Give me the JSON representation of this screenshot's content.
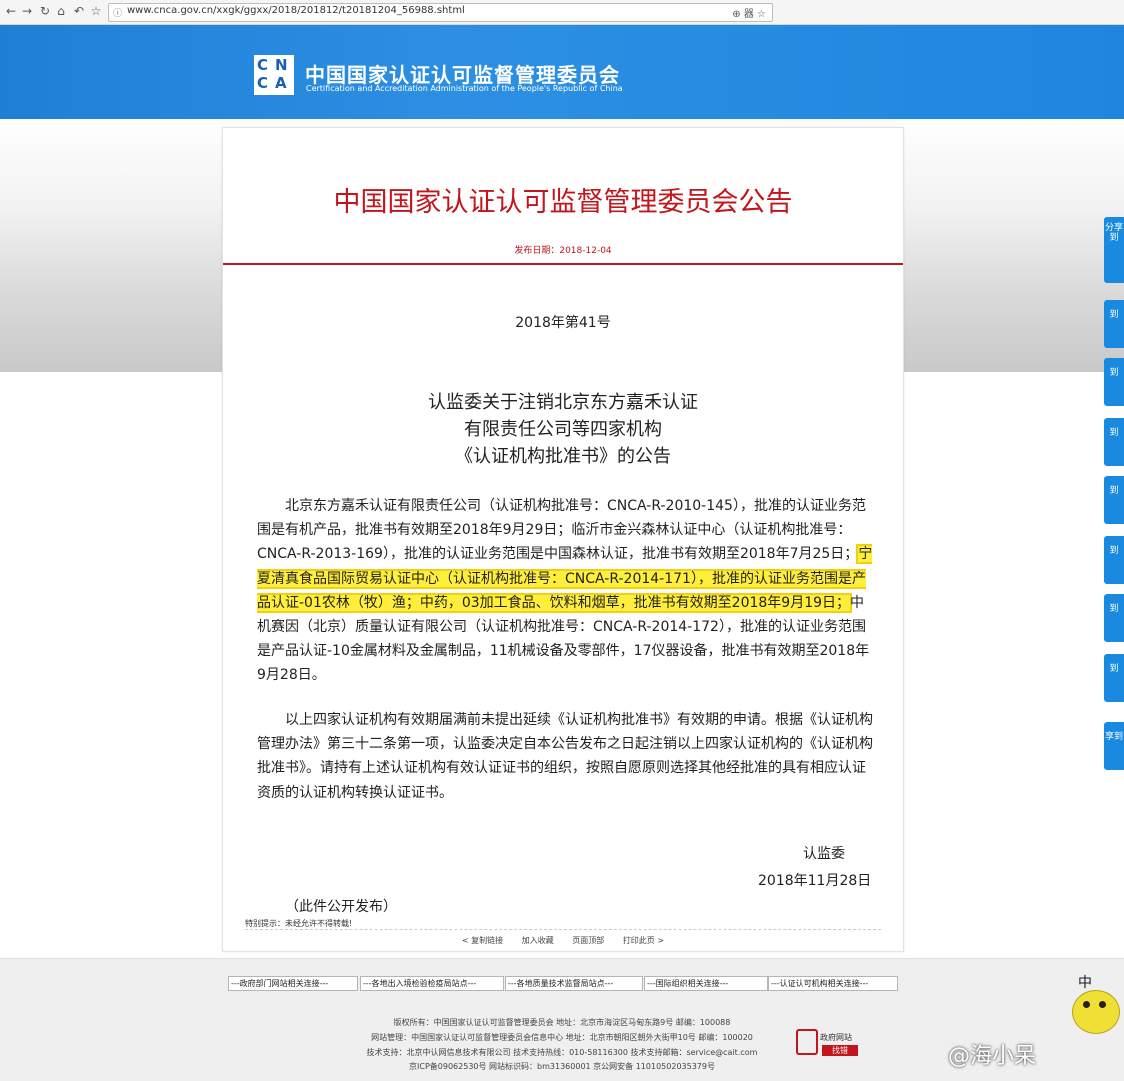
{
  "browser": {
    "url": "www.cnca.gov.cn/xxgk/ggxx/2018/201812/t20181204_56988.shtml",
    "back_icon": "arrow-left-icon",
    "forward_icon": "arrow-right-icon",
    "reload_icon": "reload-icon",
    "home_icon": "home-icon",
    "undo_icon": "undo-icon",
    "star_icon": "star-icon",
    "tools": "⊕ 器 ☆"
  },
  "header": {
    "logo_letters": [
      "C",
      "N",
      "C",
      "A"
    ],
    "org_name_cn": "中国国家认证认可监督管理委员会",
    "org_name_en": "Certification and Accreditation Administration of the People's Republic of China"
  },
  "article": {
    "title": "中国国家认证认可监督管理委员会公告",
    "publish_date": "发布日期：2018-12-04",
    "doc_number": "2018年第41号",
    "heading_lines": [
      "认监委关于注销北京东方嘉禾认证",
      "有限责任公司等四家机构",
      "《认证机构批准书》的公告"
    ],
    "para1": {
      "before": "北京东方嘉禾认证有限责任公司（认证机构批准号：CNCA-R-2010-145），批准的认证业务范围是有机产品，批准书有效期至2018年9月29日；临沂市金兴森林认证中心（认证机构批准号：CNCA-R-2013-169），批准的认证业务范围是中国森林认证，批准书有效期至2018年7月25日；",
      "highlight": "宁夏清真食品国际贸易认证中心（认证机构批准号：CNCA-R-2014-171），批准的认证业务范围是产品认证-01农林（牧）渔；中药，03加工食品、饮料和烟草，批准书有效期至2018年9月19日；",
      "after": "中机赛因（北京）质量认证有限公司（认证机构批准号：CNCA-R-2014-172），批准的认证业务范围是产品认证-10金属材料及金属制品，11机械设备及零部件，17仪器设备，批准书有效期至2018年9月28日。"
    },
    "para2": "以上四家认证机构有效期届满前未提出延续《认证机构批准书》有效期的申请。根据《认证机构管理办法》第三十二条第一项，认监委决定自本公告发布之日起注销以上四家认证机构的《认证机构批准书》。请持有上述认证机构有效认证证书的组织，按照自愿原则选择其他经批准的具有相应认证资质的认证机构转换认证证书。",
    "signature": "认监委",
    "sign_date": "2018年11月28日",
    "public_note": "（此件公开发布）",
    "special_note": "特别提示：未经允许不得转载!",
    "actions": [
      "< 复制链接",
      "加入收藏",
      "页面顶部",
      "打印此页 >"
    ]
  },
  "side_tabs": [
    {
      "label": "分享到"
    },
    {
      "label": "到"
    },
    {
      "label": "到"
    },
    {
      "label": "到"
    },
    {
      "label": "到"
    },
    {
      "label": "到"
    },
    {
      "label": "到"
    },
    {
      "label": "到"
    },
    {
      "label": "享到"
    }
  ],
  "footer": {
    "selects": [
      "---政府部门网站相关连接---",
      "---各地出入境检验检疫局站点---",
      "---各地质量技术监督局站点---",
      "---国际组织相关连接---",
      "---认证认可机构相关连接---"
    ],
    "lines": [
      "版权所有：中国国家认证认可监督管理委员会 地址：北京市海淀区马甸东路9号 邮编：100088",
      "网站管理：中国国家认证认可监督管理委员会信息中心 地址：北京市朝阳区朝外大街甲10号 邮编：100020",
      "技术支持：北京中认网信息技术有限公司 技术支持热线：010-58116300 技术支持邮箱：service@cait.com",
      "京ICP备09062530号  网站标识码：bm31360001  京公网安备 11010502035379号"
    ],
    "gov_site_label": "政府网站",
    "gov_site_button": "找错"
  },
  "watermark": {
    "text": "@海小呆",
    "char": "中"
  }
}
